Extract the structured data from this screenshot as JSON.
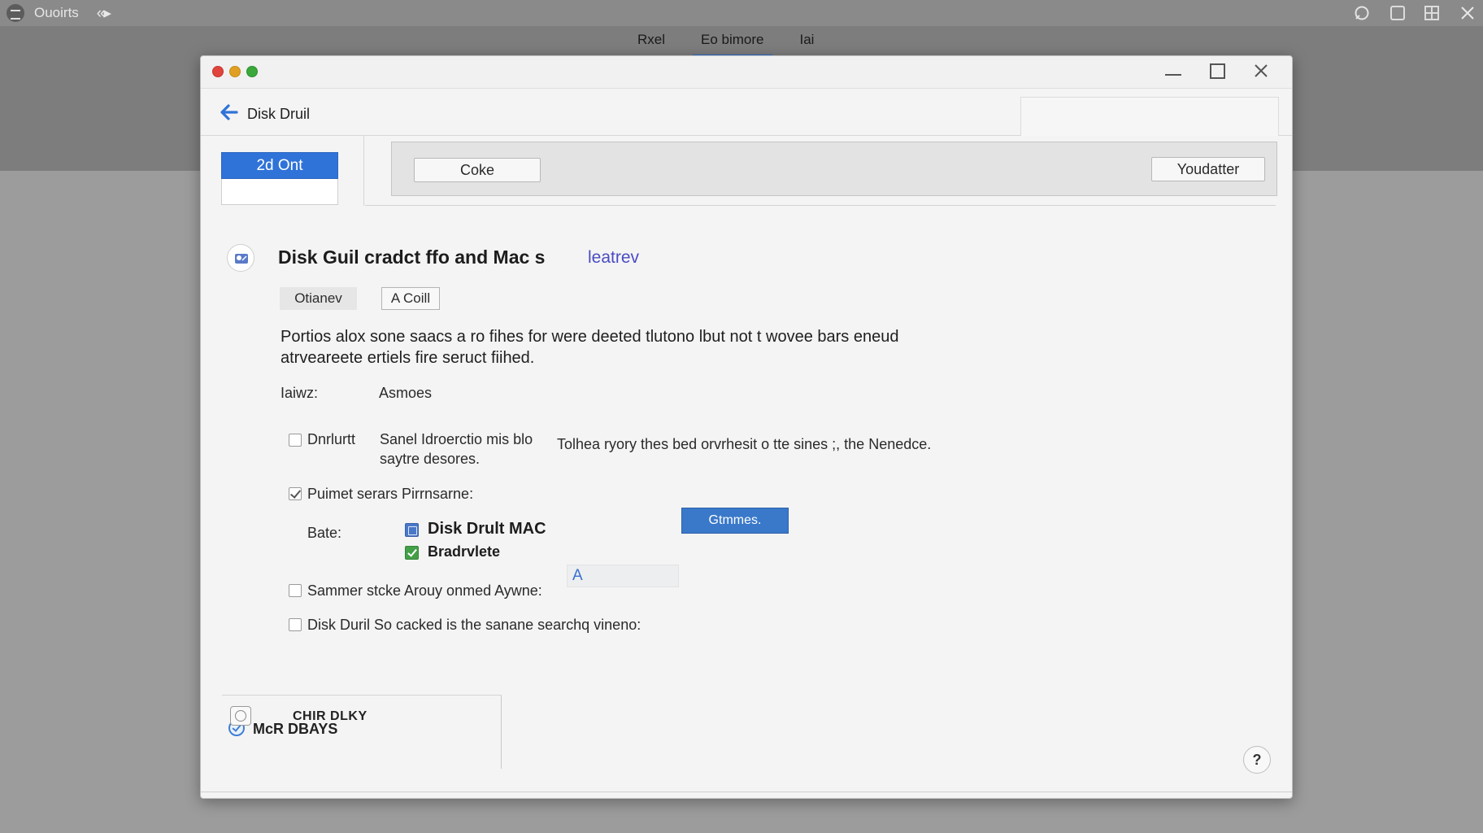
{
  "system_bar": {
    "app_name": "Ouoirts",
    "nav_arrows": "‹‹▸",
    "icons": [
      "app-menu-icon",
      "nav-back-icon",
      "refresh-icon",
      "window-icon",
      "grid-icon",
      "close-icon"
    ]
  },
  "window_tabs": [
    {
      "label": "Rxel"
    },
    {
      "label": "Eo bimore",
      "active": true
    },
    {
      "label": "Iai"
    }
  ],
  "window": {
    "title": "Disk Druil",
    "selector_button": "2d Ont",
    "toolbar": {
      "left_button": "Coke",
      "right_button": "Youdatter"
    }
  },
  "content": {
    "heading": "Disk  Guil cradct ffo and Mac s",
    "heading_link": "leatrev",
    "chips": [
      "Otianev",
      "A Coill"
    ],
    "description": "Portios alox sone saacs a ro fihes for were deeted tlutono lbut not t wovee bars eneud atrveareete ertiels fire seruct fiihed.",
    "field_label": "Iaiwz:",
    "field_value": "Asmoes",
    "options": [
      {
        "label": "Dnrlurtt",
        "checked": false,
        "description_line1": "Sanel Idroerctio mis blo",
        "description_line2": "saytre desores.",
        "description_inline": "Tolhea ryory thes  bed orvrhesit o tte sines ;, the Nenedce."
      },
      {
        "label": "Puimet serars Pirrnsarne:",
        "checked": true
      }
    ],
    "base": {
      "label": "Bate:",
      "item1": "Disk Drult MAC",
      "item2": "Bradrvlete",
      "field_value": "A",
      "action_button": "Gtmmes."
    },
    "more_options": [
      {
        "label": "Sammer stcke Arouy onmed Aywne:",
        "checked": false
      },
      {
        "label": "Disk Duril So cacked is the sanane searchq vineno:",
        "checked": false
      }
    ],
    "section": {
      "title": "McR DBAYS",
      "item": "CHIR DLKY"
    },
    "help_label": "?"
  },
  "colors": {
    "accent": "#2f73d8",
    "link": "#4b4bc4",
    "button_blue": "#3a78c9",
    "traffic_red": "#e0443c",
    "traffic_yellow": "#dfa024",
    "traffic_green": "#3aa83a"
  }
}
